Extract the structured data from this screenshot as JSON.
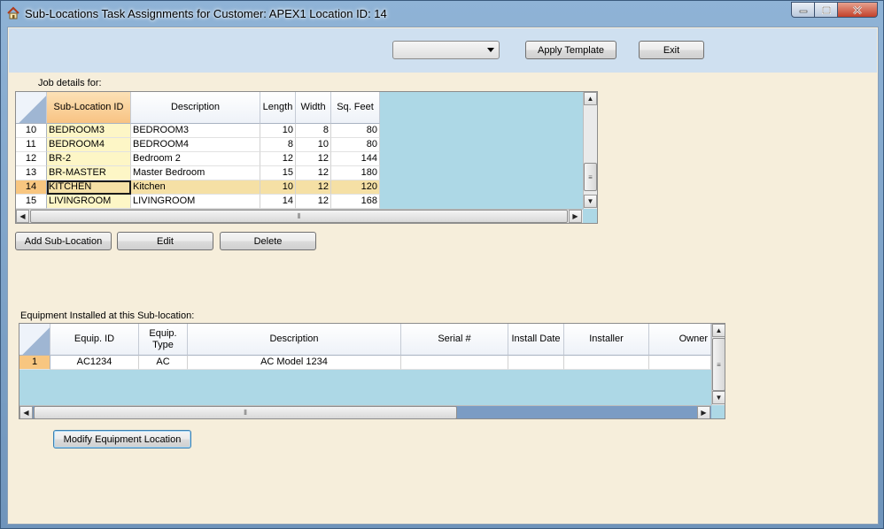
{
  "window": {
    "title": "Sub-Locations Task Assignments for Customer: APEX1  Location ID: 14",
    "icons": {
      "app": "home-icon",
      "minimize": "minimize-icon",
      "maximize": "maximize-icon",
      "close": "close-icon"
    }
  },
  "toolbar": {
    "template_select_value": "",
    "apply_template_label": "Apply Template",
    "exit_label": "Exit"
  },
  "job_details": {
    "label": "Job details for:",
    "columns": [
      "Sub-Location ID",
      "Description",
      "Length",
      "Width",
      "Sq. Feet"
    ],
    "rows": [
      {
        "row": "10",
        "id": "BEDROOM3",
        "description": "BEDROOM3",
        "length": "10",
        "width": "8",
        "sqft": "80"
      },
      {
        "row": "11",
        "id": "BEDROOM4",
        "description": "BEDROOM4",
        "length": "8",
        "width": "10",
        "sqft": "80"
      },
      {
        "row": "12",
        "id": "BR-2",
        "description": "Bedroom 2",
        "length": "12",
        "width": "12",
        "sqft": "144"
      },
      {
        "row": "13",
        "id": "BR-MASTER",
        "description": "Master Bedroom",
        "length": "15",
        "width": "12",
        "sqft": "180"
      },
      {
        "row": "14",
        "id": "KITCHEN",
        "description": "Kitchen",
        "length": "10",
        "width": "12",
        "sqft": "120"
      },
      {
        "row": "15",
        "id": "LIVINGROOM",
        "description": "LIVINGROOM",
        "length": "14",
        "width": "12",
        "sqft": "168"
      }
    ],
    "selected_row": "14",
    "add_label": "Add Sub-Location",
    "edit_label": "Edit",
    "delete_label": "Delete"
  },
  "equipment": {
    "label": "Equipment Installed at this Sub-location:",
    "columns": [
      "Equip. ID",
      "Equip. Type",
      "Description",
      "Serial #",
      "Install Date",
      "Installer",
      "Owner"
    ],
    "rows": [
      {
        "row": "1",
        "equip_id": "AC1234",
        "equip_type": "AC",
        "description": "AC Model 1234",
        "serial": "",
        "install_date": "",
        "installer": "",
        "owner": ""
      }
    ],
    "modify_label": "Modify Equipment Location"
  },
  "colors": {
    "client_bg": "#f6eedb",
    "band_bg": "#cfe0f0",
    "grid_bg": "#add8e6",
    "selected_header": "#f8c383",
    "key_column": "#fdf6c6"
  }
}
